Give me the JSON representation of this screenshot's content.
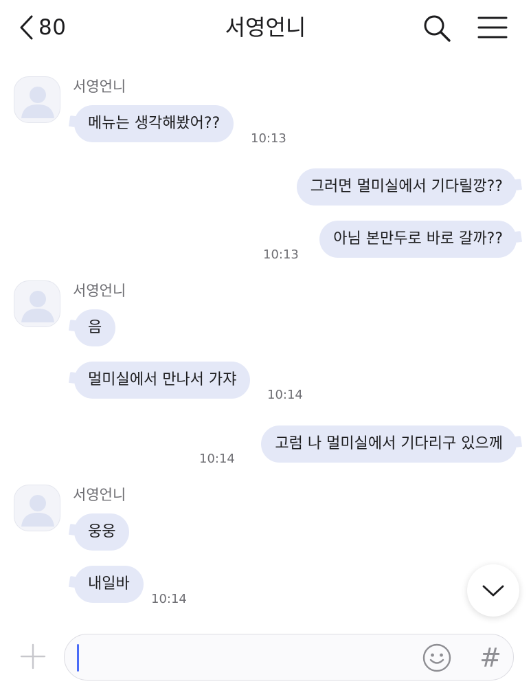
{
  "header": {
    "unread_count": "80",
    "chat_title": "서영언니"
  },
  "messages": [
    {
      "sender": "서영언니",
      "bubbles": [
        "메뉴는 생각해봤어??"
      ],
      "time": "10:13"
    },
    {
      "mine": true,
      "bubbles": [
        "그러면 멀미실에서 기다릴깡??",
        "아님 본만두로 바로 갈까??"
      ],
      "time": "10:13"
    },
    {
      "sender": "서영언니",
      "bubbles": [
        "음",
        "멀미실에서 만나서 가쟈"
      ],
      "time": "10:14"
    },
    {
      "mine": true,
      "bubbles": [
        "고럼 나 멀미실에서 기다리구 있으께"
      ],
      "time": "10:14"
    },
    {
      "sender": "서영언니",
      "bubbles": [
        "웅웅",
        "내일바"
      ],
      "time": "10:14"
    }
  ],
  "composer": {
    "value": "",
    "placeholder": ""
  },
  "icons": {
    "back": "chevron-left-icon",
    "search": "search-icon",
    "menu": "hamburger-menu-icon",
    "scroll_down": "chevron-down-icon",
    "plus": "plus-icon",
    "emoji": "emoji-icon",
    "hashtag": "hashtag-icon"
  },
  "colors": {
    "bubble": "#e4e8f7",
    "caret": "#4a6cf7",
    "secondary_text": "#6e6e73"
  }
}
